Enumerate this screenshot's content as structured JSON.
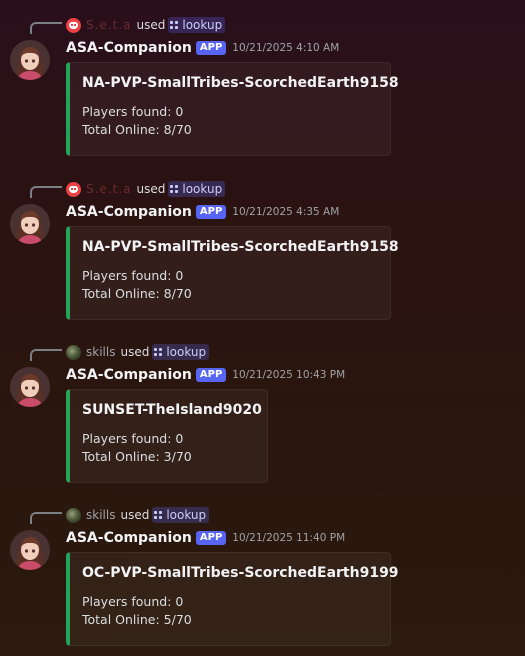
{
  "messages": [
    {
      "reply": {
        "user": "S.e.t.a",
        "used": "used",
        "command": "lookup",
        "user_avatar_icon": "discord-icon"
      },
      "author": "ASA-Companion",
      "badge": "APP",
      "timestamp": "10/21/2025 4:10 AM",
      "embed": {
        "title": "NA-PVP-SmallTribes-ScorchedEarth9158",
        "players_found": "Players found: 0",
        "total_online": "Total Online: 8/70",
        "accent_color": "#23a559"
      }
    },
    {
      "reply": {
        "user": "S.e.t.a",
        "used": "used",
        "command": "lookup",
        "user_avatar_icon": "discord-icon"
      },
      "author": "ASA-Companion",
      "badge": "APP",
      "timestamp": "10/21/2025 4:35 AM",
      "embed": {
        "title": "NA-PVP-SmallTribes-ScorchedEarth9158",
        "players_found": "Players found: 0",
        "total_online": "Total Online: 8/70",
        "accent_color": "#23a559"
      }
    },
    {
      "reply": {
        "user": "skills",
        "used": "used",
        "command": "lookup",
        "user_avatar_icon": "skills-avatar"
      },
      "author": "ASA-Companion",
      "badge": "APP",
      "timestamp": "10/21/2025 10:43 PM",
      "embed": {
        "title": "SUNSET-TheIsland9020",
        "players_found": "Players found: 0",
        "total_online": "Total Online: 3/70",
        "accent_color": "#23a559"
      }
    },
    {
      "reply": {
        "user": "skills",
        "used": "used",
        "command": "lookup",
        "user_avatar_icon": "skills-avatar"
      },
      "author": "ASA-Companion",
      "badge": "APP",
      "timestamp": "10/21/2025 11:40 PM",
      "embed": {
        "title": "OC-PVP-SmallTribes-ScorchedEarth9199",
        "players_found": "Players found: 0",
        "total_online": "Total Online: 5/70",
        "accent_color": "#23a559"
      }
    }
  ]
}
